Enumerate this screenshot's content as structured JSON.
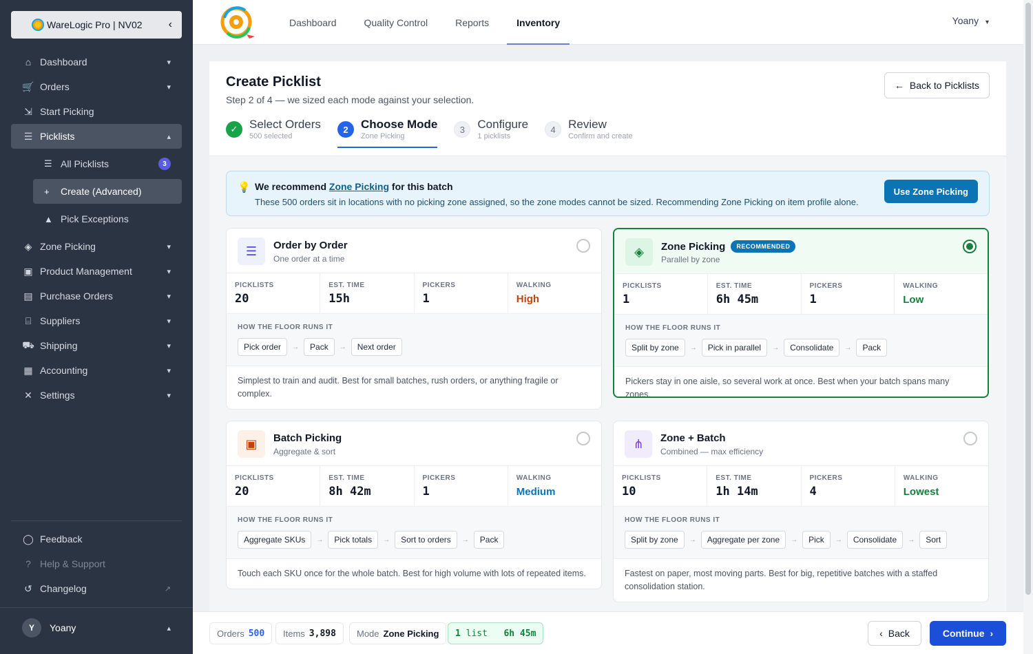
{
  "brand": {
    "name": "WareLogic Pro | NV02",
    "collapse_icon": "chevron-left-icon"
  },
  "sidebar": {
    "items": [
      {
        "label": "Dashboard",
        "icon": "home-icon"
      },
      {
        "label": "Orders",
        "icon": "cart-icon"
      },
      {
        "label": "Start Picking",
        "icon": "cart-arrow-icon"
      },
      {
        "label": "Picklists",
        "icon": "list-icon"
      },
      {
        "label": "Zone Picking",
        "icon": "layers-icon"
      },
      {
        "label": "Product Management",
        "icon": "boxes-icon"
      },
      {
        "label": "Purchase Orders",
        "icon": "document-icon"
      },
      {
        "label": "Suppliers",
        "icon": "warehouse-icon"
      },
      {
        "label": "Shipping",
        "icon": "truck-icon"
      },
      {
        "label": "Accounting",
        "icon": "calculator-icon"
      },
      {
        "label": "Settings",
        "icon": "tools-icon"
      }
    ],
    "picklists_sub": [
      {
        "label": "All Picklists",
        "badge": "3"
      },
      {
        "label": "Create (Advanced)"
      },
      {
        "label": "Pick Exceptions"
      }
    ],
    "bottom": [
      {
        "label": "Feedback"
      },
      {
        "label": "Help & Support"
      },
      {
        "label": "Changelog"
      }
    ],
    "user": {
      "initial": "Y",
      "name": "Yoany"
    }
  },
  "topbar": {
    "tabs": [
      "Dashboard",
      "Quality Control",
      "Reports",
      "Inventory"
    ],
    "active_tab": "Inventory",
    "user": "Yoany"
  },
  "page": {
    "title": "Create Picklist",
    "subtitle": "Step 2 of 4 — we sized each mode against your selection.",
    "back_button": "Back to Picklists"
  },
  "steps": [
    {
      "num": "✓",
      "title": "Select Orders",
      "caption": "500 selected",
      "state": "done"
    },
    {
      "num": "2",
      "title": "Choose Mode",
      "caption": "Zone Picking",
      "state": "current"
    },
    {
      "num": "3",
      "title": "Configure",
      "caption": "1 picklists",
      "state": "todo"
    },
    {
      "num": "4",
      "title": "Review",
      "caption": "Confirm and create",
      "state": "todo"
    }
  ],
  "recommendation": {
    "prefix": "We recommend ",
    "mode": "Zone Picking",
    "suffix": " for this batch",
    "text": "These 500 orders sit in locations with no picking zone assigned, so the zone modes cannot be sized. Recommending Zone Picking on item profile alone.",
    "button": "Use Zone Picking"
  },
  "stat_labels": {
    "picklists": "PICKLISTS",
    "time": "EST. TIME",
    "pickers": "PICKERS",
    "walking": "WALKING"
  },
  "flow_label": "HOW THE FLOOR RUNS IT",
  "modes": [
    {
      "title": "Order by Order",
      "desc": "One order at a time",
      "icon": "numbered-list-icon",
      "picklists": "20",
      "time": "15h",
      "pickers": "1",
      "walking": "High",
      "flow": [
        "Pick order",
        "Pack",
        "Next order"
      ],
      "note": "Simplest to train and audit. Best for small batches, rush orders, or anything fragile or complex."
    },
    {
      "title": "Zone Picking",
      "desc": "Parallel by zone",
      "icon": "layers-icon",
      "badge": "RECOMMENDED",
      "picklists": "1",
      "time": "6h 45m",
      "pickers": "1",
      "walking": "Low",
      "flow": [
        "Split by zone",
        "Pick in parallel",
        "Consolidate",
        "Pack"
      ],
      "note": "Pickers stay in one aisle, so several work at once. Best when your batch spans many zones."
    },
    {
      "title": "Batch Picking",
      "desc": "Aggregate & sort",
      "icon": "boxes-icon",
      "picklists": "20",
      "time": "8h 42m",
      "pickers": "1",
      "walking": "Medium",
      "flow": [
        "Aggregate SKUs",
        "Pick totals",
        "Sort to orders",
        "Pack"
      ],
      "note": "Touch each SKU once for the whole batch. Best for high volume with lots of repeated items."
    },
    {
      "title": "Zone + Batch",
      "desc": "Combined — max efficiency",
      "icon": "sitemap-icon",
      "picklists": "10",
      "time": "1h 14m",
      "pickers": "4",
      "walking": "Lowest",
      "flow": [
        "Split by zone",
        "Aggregate per zone",
        "Pick",
        "Consolidate",
        "Sort"
      ],
      "note": "Fastest on paper, most moving parts. Best for big, repetitive batches with a staffed consolidation station."
    }
  ],
  "summary": {
    "orders_label": "Orders",
    "orders": "500",
    "items_label": "Items",
    "items": "3,898",
    "mode_label": "Mode",
    "mode": "Zone Picking",
    "lists_num": "1",
    "lists_word": "list",
    "time": "6h 45m"
  },
  "footer": {
    "back": "Back",
    "continue": "Continue"
  },
  "colors": {
    "accent": "#1d4ed8",
    "selected": "#15803d",
    "sidebar": "#2b3442"
  }
}
